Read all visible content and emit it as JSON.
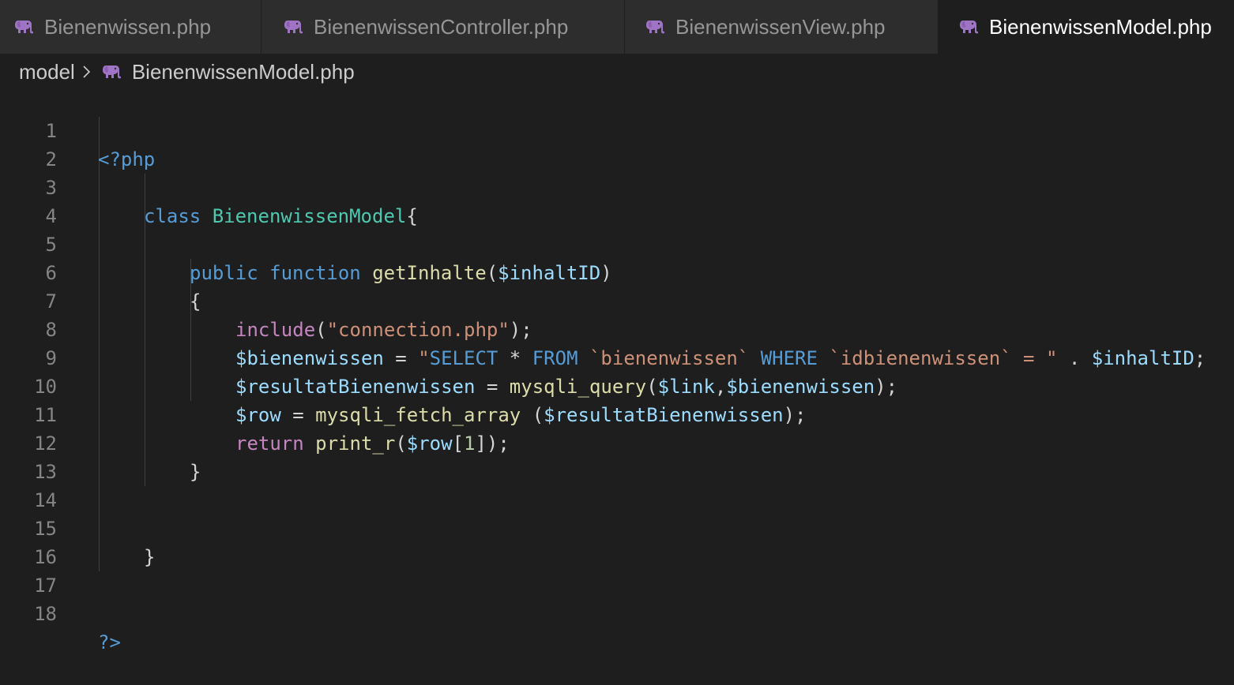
{
  "tabs": [
    {
      "label": "Bienenwissen.php",
      "active": false
    },
    {
      "label": "BienenwissenController.php",
      "active": false
    },
    {
      "label": "BienenwissenView.php",
      "active": false
    },
    {
      "label": "BienenwissenModel.php",
      "active": true
    }
  ],
  "breadcrumb": {
    "folder": "model",
    "file": "BienenwissenModel.php"
  },
  "icons": {
    "file_icon": "php-elephant-icon",
    "separator": "chevron-right-icon"
  },
  "colors": {
    "php_icon": "#a074c4",
    "background": "#1e1e1e"
  },
  "line_numbers": [
    "1",
    "2",
    "3",
    "4",
    "5",
    "6",
    "7",
    "8",
    "9",
    "10",
    "11",
    "12",
    "13",
    "14",
    "15",
    "16",
    "17",
    "18"
  ],
  "code": {
    "l1": {
      "open_tag": "<?php"
    },
    "l3": {
      "kw": "class",
      "name": "BienenwissenModel",
      "brace": "{"
    },
    "l5": {
      "kw1": "public",
      "kw2": "function",
      "fn": "getInhalte",
      "open": "(",
      "param": "$inhaltID",
      "close": ")"
    },
    "l6": {
      "brace": "{"
    },
    "l7": {
      "kw": "include",
      "open": "(",
      "str": "\"connection.php\"",
      "close": ");"
    },
    "l8": {
      "var": "$bienenwissen",
      "eq": " = ",
      "q1": "\"",
      "sql1": "SELECT",
      "star": " * ",
      "sql2": "FROM",
      "t1": " `bienenwissen` ",
      "sql3": "WHERE",
      "t2": " `idbienenwissen` = \"",
      "dot": " . ",
      "var2": "$inhaltID",
      "end": ";"
    },
    "l9": {
      "var": "$resultatBienenwissen",
      "eq": " = ",
      "fn": "mysqli_query",
      "open": "(",
      "a1": "$link",
      "comma": ",",
      "a2": "$bienenwissen",
      "close": ");"
    },
    "l10": {
      "var": "$row",
      "eq": " = ",
      "fn": "mysqli_fetch_array",
      "open": " (",
      "a1": "$resultatBienenwissen",
      "close": ");"
    },
    "l11": {
      "kw": "return",
      "sp": " ",
      "fn": "print_r",
      "open": "(",
      "var": "$row",
      "b1": "[",
      "num": "1",
      "b2": "]",
      "close": ");"
    },
    "l12": {
      "brace": "}"
    },
    "l15": {
      "brace": "}"
    },
    "l18": {
      "close_tag": "?>"
    }
  }
}
